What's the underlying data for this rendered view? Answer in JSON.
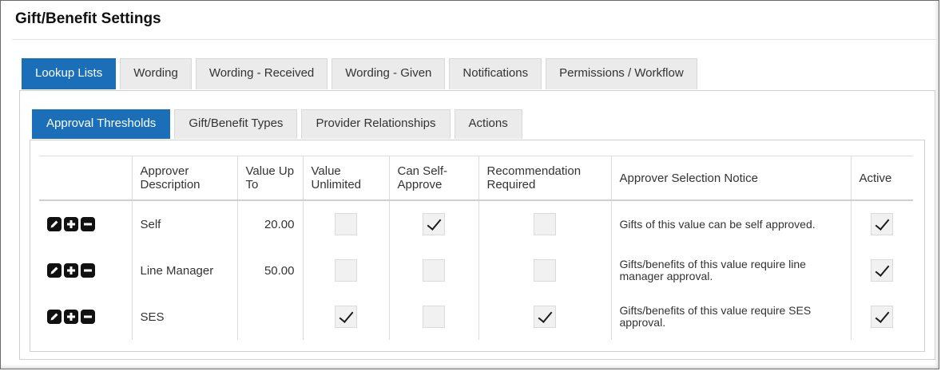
{
  "page": {
    "title": "Gift/Benefit Settings"
  },
  "main_tabs": [
    {
      "label": "Lookup Lists",
      "active": true
    },
    {
      "label": "Wording",
      "active": false
    },
    {
      "label": "Wording - Received",
      "active": false
    },
    {
      "label": "Wording - Given",
      "active": false
    },
    {
      "label": "Notifications",
      "active": false
    },
    {
      "label": "Permissions / Workflow",
      "active": false
    }
  ],
  "sub_tabs": [
    {
      "label": "Approval Thresholds",
      "active": true
    },
    {
      "label": "Gift/Benefit Types",
      "active": false
    },
    {
      "label": "Provider Relationships",
      "active": false
    },
    {
      "label": "Actions",
      "active": false
    }
  ],
  "table": {
    "headers": {
      "approver_description": "Approver Description",
      "value_up_to": "Value Up To",
      "value_unlimited": "Value Unlimited",
      "can_self_approve": "Can Self-Approve",
      "recommendation_required": "Recommendation Required",
      "approver_selection_notice": "Approver Selection Notice",
      "active": "Active"
    },
    "rows": [
      {
        "description": "Self",
        "value_up_to": "20.00",
        "value_unlimited": false,
        "can_self_approve": true,
        "recommendation_required": false,
        "notice": "Gifts of this value can be self approved.",
        "active": true
      },
      {
        "description": "Line Manager",
        "value_up_to": "50.00",
        "value_unlimited": false,
        "can_self_approve": false,
        "recommendation_required": false,
        "notice": "Gifts/benefits of this value require line manager approval.",
        "active": true
      },
      {
        "description": "SES",
        "value_up_to": "",
        "value_unlimited": true,
        "can_self_approve": false,
        "recommendation_required": true,
        "notice": "Gifts/benefits of this value require SES approval.",
        "active": true
      }
    ],
    "row_action_icons": [
      "edit-icon",
      "add-icon",
      "remove-icon"
    ]
  },
  "colors": {
    "accent": "#1b6fb8",
    "tab_bg": "#ebebeb",
    "checkbox_bg": "#f1f1f1"
  }
}
